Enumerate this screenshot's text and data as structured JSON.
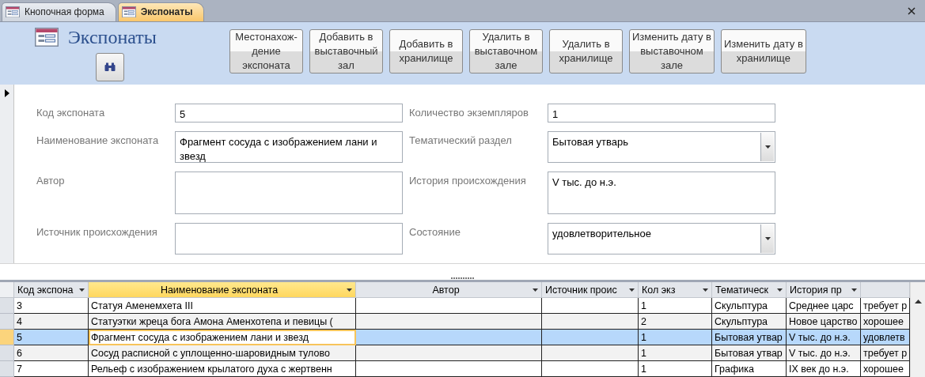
{
  "tabs": [
    {
      "label": "Кнопочная форма",
      "selected": false
    },
    {
      "label": "Экспонаты",
      "selected": true
    }
  ],
  "header": {
    "title": "Экспонаты",
    "buttons": [
      "Местонахож-\nдение\nэкспоната",
      "Добавить в\nвыставочный\nзал",
      "Добавить в\nхранилище",
      "Удалить в\nвыставочном\nзале",
      "Удалить в\nхранилище",
      "Изменить дату в\nвыставочном\nзале",
      "Изменить дату в\nхранилище"
    ]
  },
  "form": {
    "left": [
      {
        "label": "Код экспоната",
        "kind": "text",
        "value": "5"
      },
      {
        "label": "Наименование экспоната",
        "kind": "text",
        "value": "Фрагмент сосуда с изображением лани и звезд"
      },
      {
        "label": "Автор",
        "kind": "text"
      },
      {
        "label": "Источник происхождения",
        "kind": "text"
      }
    ],
    "right": [
      {
        "label": "Количество экземпляров",
        "kind": "text",
        "value": "1"
      },
      {
        "label": "Тематический раздел",
        "kind": "combo",
        "value": "Бытовая утварь"
      },
      {
        "label": "История происхождения",
        "kind": "text",
        "value": "V тыс. до н.э."
      },
      {
        "label": "Состояние",
        "kind": "combo",
        "value": "удовлетворительное"
      }
    ]
  },
  "table": {
    "columns": [
      {
        "label": "Код экспона",
        "selected": false
      },
      {
        "label": "Наименование экспоната",
        "selected": true
      },
      {
        "label": "Автор",
        "selected": false
      },
      {
        "label": "Источник проис",
        "selected": false
      },
      {
        "label": "Кол экз",
        "selected": false
      },
      {
        "label": "Тематическ",
        "selected": false
      },
      {
        "label": "История пр",
        "selected": false
      },
      {
        "selected": false
      }
    ],
    "rows": [
      {
        "selected": false,
        "cells": [
          "3",
          "Статуя Аменемхета III",
          null,
          null,
          "1",
          "Скульптура",
          "Среднее царс",
          "требует р"
        ]
      },
      {
        "selected": false,
        "cells": [
          "4",
          "Статуэтки жреца бога Амона Аменхотепа и певицы (",
          null,
          null,
          "2",
          "Скульптура",
          "Новое царство",
          "хорошее"
        ]
      },
      {
        "selected": true,
        "cells": [
          "5",
          "Фрагмент сосуда с изображением лани и звезд",
          null,
          null,
          "1",
          "Бытовая утвар",
          "V тыс. до н.э.",
          "удовлетв"
        ]
      },
      {
        "selected": false,
        "cells": [
          "6",
          "Сосуд расписной с уплощенно-шаровидным тулово",
          null,
          null,
          "1",
          "Бытовая утвар",
          "V тыс. до н.э.",
          "требует р"
        ]
      },
      {
        "selected": false,
        "cells": [
          "7",
          "Рельеф с изображением крылатого духа с жертвенн",
          null,
          null,
          "1",
          "Графика",
          "IX век до н.э.",
          "хорошее"
        ]
      }
    ]
  }
}
